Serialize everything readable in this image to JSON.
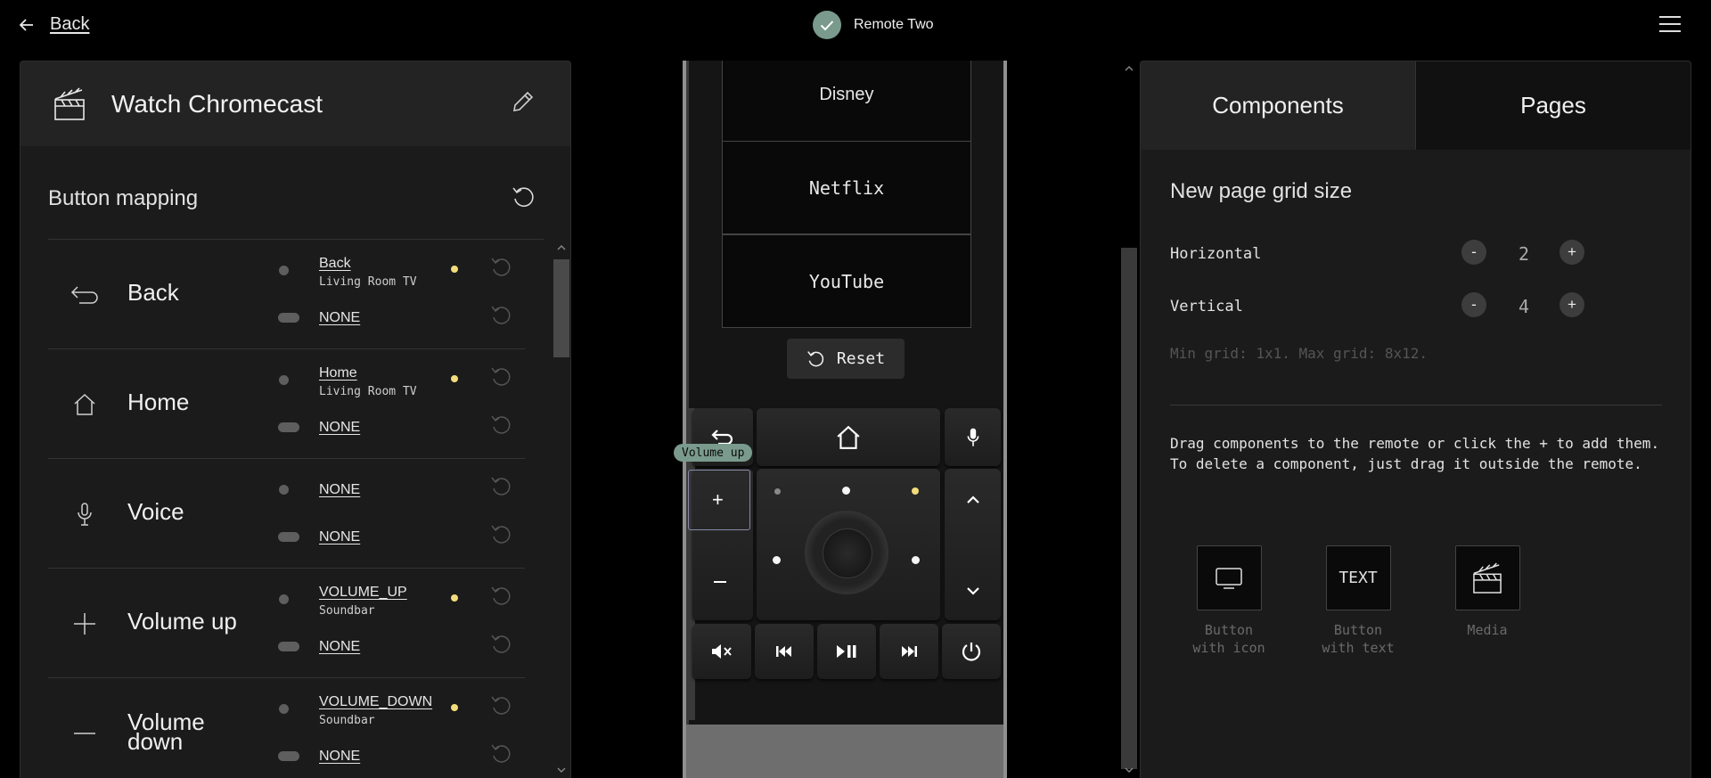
{
  "topbar": {
    "back_label": "Back",
    "device_name": "Remote Two"
  },
  "activity": {
    "title": "Watch Chromecast"
  },
  "mapping": {
    "title": "Button mapping",
    "rows": [
      {
        "name": "Back",
        "icon": "back-arrow-icon",
        "short_action": "Back",
        "short_entity": "Living Room TV",
        "long_action": "NONE"
      },
      {
        "name": "Home",
        "icon": "home-icon",
        "short_action": "Home",
        "short_entity": "Living Room TV",
        "long_action": "NONE"
      },
      {
        "name": "Voice",
        "icon": "microphone-icon",
        "short_action": "NONE",
        "short_entity": "",
        "long_action": "NONE"
      },
      {
        "name": "Volume up",
        "icon": "plus-icon",
        "short_action": "VOLUME_UP",
        "short_entity": "Soundbar",
        "long_action": "NONE"
      },
      {
        "name_line1": "Volume",
        "name_line2": "down",
        "icon": "minus-icon",
        "short_action": "VOLUME_DOWN",
        "short_entity": "Soundbar",
        "long_action": "NONE"
      }
    ]
  },
  "remote": {
    "list_buttons": [
      "Disney",
      "Netflix",
      "YouTube"
    ],
    "reset_label": "Reset",
    "tooltip": "Volume up"
  },
  "right": {
    "tabs": [
      "Components",
      "Pages"
    ],
    "grid_title": "New page grid size",
    "horizontal_label": "Horizontal",
    "horizontal_value": "2",
    "vertical_label": "Vertical",
    "vertical_value": "4",
    "minus": "-",
    "plus": "+",
    "grid_hint": "Min grid: 1x1. Max grid: 8x12.",
    "instructions": "Drag components to the remote or click the + to add them. To delete a component, just drag it outside the remote.",
    "components": [
      {
        "line1": "Button",
        "line2": "with icon",
        "icon": "tv-icon"
      },
      {
        "line1": "Button",
        "line2": "with text",
        "box_text": "TEXT"
      },
      {
        "line1": "Media",
        "line2": "",
        "icon": "clapperboard-icon"
      }
    ]
  },
  "colors": {
    "accent": "#7a9a8e",
    "indicator_yellow": "#f3dc7a",
    "indicator_red": "#e04545"
  }
}
